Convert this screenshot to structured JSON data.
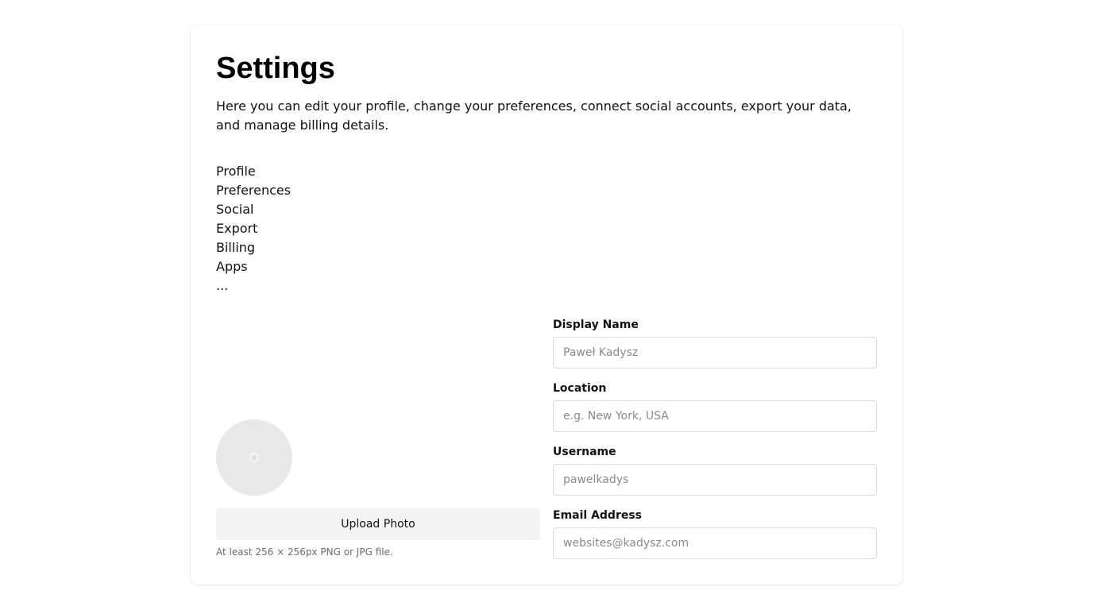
{
  "page": {
    "title": "Settings",
    "description": "Here you can edit your profile, change your preferences, connect social accounts, export your data, and manage billing details."
  },
  "nav": {
    "items": [
      "Profile",
      "Preferences",
      "Social",
      "Export",
      "Billing",
      "Apps",
      "..."
    ]
  },
  "profile": {
    "avatar_icon": "avatar-placeholder-icon",
    "upload_label": "Upload Photo",
    "upload_hint": "At least 256 × 256px PNG or JPG file."
  },
  "form": {
    "display_name": {
      "label": "Display Name",
      "value": "",
      "placeholder": "Paweł Kadysz"
    },
    "location": {
      "label": "Location",
      "value": "",
      "placeholder": "e.g. New York, USA"
    },
    "username": {
      "label": "Username",
      "value": "",
      "placeholder": "pawelkadys"
    },
    "email": {
      "label": "Email Address",
      "value": "",
      "placeholder": "websites@kadysz.com"
    }
  }
}
